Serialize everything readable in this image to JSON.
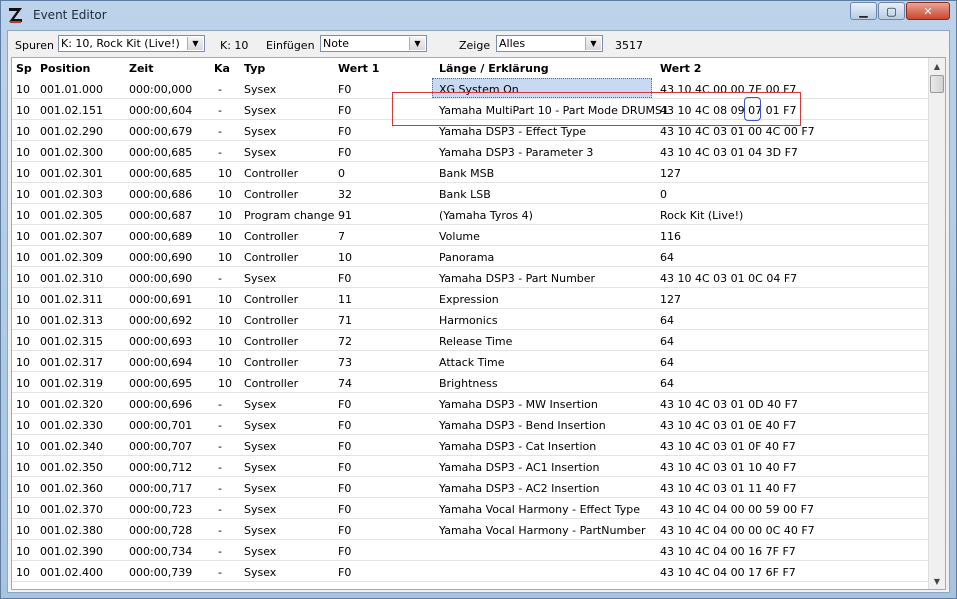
{
  "window": {
    "title": "Event Editor"
  },
  "toolbar": {
    "spuren_label": "Spuren",
    "spuren_value": "K: 10, Rock Kit (Live!)",
    "channel_label": "K: 10",
    "einfuegen_label": "Einfügen",
    "einfuegen_value": "Note",
    "zeige_label": "Zeige",
    "zeige_value": "Alles",
    "count": "3517"
  },
  "table": {
    "headers": [
      "Sp",
      "Position",
      "Zeit",
      "Ka",
      "Typ",
      "Wert 1",
      "Länge / Erklärung",
      "Wert 2"
    ],
    "rows": [
      [
        "10",
        "001.01.000",
        "000:00,000",
        "-",
        "Sysex",
        "F0",
        "XG System On",
        "43 10 4C 00 00 7E 00 F7"
      ],
      [
        "10",
        "001.02.151",
        "000:00,604",
        "-",
        "Sysex",
        "F0",
        "Yamaha MultiPart 10 - Part Mode DRUMS1",
        "43 10 4C 08 09 07 01 F7"
      ],
      [
        "10",
        "001.02.290",
        "000:00,679",
        "-",
        "Sysex",
        "F0",
        "Yamaha DSP3 - Effect Type",
        "43 10 4C 03 01 00 4C 00 F7"
      ],
      [
        "10",
        "001.02.300",
        "000:00,685",
        "-",
        "Sysex",
        "F0",
        "Yamaha DSP3 - Parameter 3",
        "43 10 4C 03 01 04 3D F7"
      ],
      [
        "10",
        "001.02.301",
        "000:00,685",
        "10",
        "Controller",
        "0",
        "Bank MSB",
        "127"
      ],
      [
        "10",
        "001.02.303",
        "000:00,686",
        "10",
        "Controller",
        "32",
        "Bank LSB",
        "0"
      ],
      [
        "10",
        "001.02.305",
        "000:00,687",
        "10",
        "Program change",
        "91",
        "(Yamaha Tyros 4)",
        "Rock Kit (Live!)"
      ],
      [
        "10",
        "001.02.307",
        "000:00,689",
        "10",
        "Controller",
        "7",
        "Volume",
        "116"
      ],
      [
        "10",
        "001.02.309",
        "000:00,690",
        "10",
        "Controller",
        "10",
        "Panorama",
        "64"
      ],
      [
        "10",
        "001.02.310",
        "000:00,690",
        "-",
        "Sysex",
        "F0",
        "Yamaha DSP3 - Part Number",
        "43 10 4C 03 01 0C 04 F7"
      ],
      [
        "10",
        "001.02.311",
        "000:00,691",
        "10",
        "Controller",
        "11",
        "Expression",
        "127"
      ],
      [
        "10",
        "001.02.313",
        "000:00,692",
        "10",
        "Controller",
        "71",
        "Harmonics",
        "64"
      ],
      [
        "10",
        "001.02.315",
        "000:00,693",
        "10",
        "Controller",
        "72",
        "Release Time",
        "64"
      ],
      [
        "10",
        "001.02.317",
        "000:00,694",
        "10",
        "Controller",
        "73",
        "Attack Time",
        "64"
      ],
      [
        "10",
        "001.02.319",
        "000:00,695",
        "10",
        "Controller",
        "74",
        "Brightness",
        "64"
      ],
      [
        "10",
        "001.02.320",
        "000:00,696",
        "-",
        "Sysex",
        "F0",
        "Yamaha DSP3 - MW Insertion",
        "43 10 4C 03 01 0D 40 F7"
      ],
      [
        "10",
        "001.02.330",
        "000:00,701",
        "-",
        "Sysex",
        "F0",
        "Yamaha DSP3 - Bend Insertion",
        "43 10 4C 03 01 0E 40 F7"
      ],
      [
        "10",
        "001.02.340",
        "000:00,707",
        "-",
        "Sysex",
        "F0",
        "Yamaha DSP3 - Cat Insertion",
        "43 10 4C 03 01 0F 40 F7"
      ],
      [
        "10",
        "001.02.350",
        "000:00,712",
        "-",
        "Sysex",
        "F0",
        "Yamaha DSP3 - AC1 Insertion",
        "43 10 4C 03 01 10 40 F7"
      ],
      [
        "10",
        "001.02.360",
        "000:00,717",
        "-",
        "Sysex",
        "F0",
        "Yamaha DSP3 - AC2 Insertion",
        "43 10 4C 03 01 11 40 F7"
      ],
      [
        "10",
        "001.02.370",
        "000:00,723",
        "-",
        "Sysex",
        "F0",
        "Yamaha Vocal Harmony - Effect Type",
        "43 10 4C 04 00 00 59 00 F7"
      ],
      [
        "10",
        "001.02.380",
        "000:00,728",
        "-",
        "Sysex",
        "F0",
        "Yamaha Vocal Harmony - PartNumber",
        "43 10 4C 04 00 00 0C 40 F7"
      ],
      [
        "10",
        "001.02.390",
        "000:00,734",
        "-",
        "Sysex",
        "F0",
        "",
        "43 10 4C 04 00 16 7F F7"
      ],
      [
        "10",
        "001.02.400",
        "000:00,739",
        "-",
        "Sysex",
        "F0",
        "",
        "43 10 4C 04 00 17 6F F7"
      ]
    ]
  }
}
